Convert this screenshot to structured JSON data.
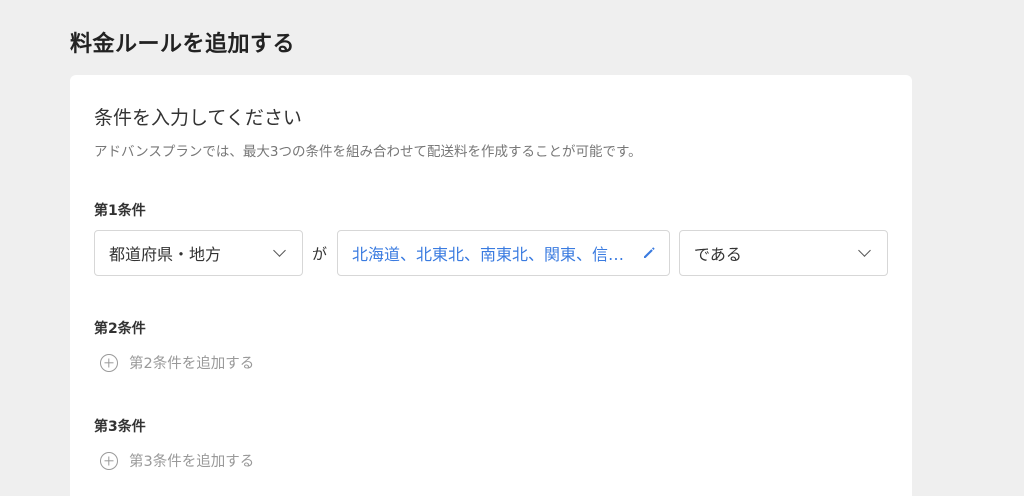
{
  "page": {
    "title": "料金ルールを追加する"
  },
  "section": {
    "title": "条件を入力してください",
    "description": "アドバンスプランでは、最大3つの条件を組み合わせて配送料を作成することが可能です。"
  },
  "condition1": {
    "label": "第1条件",
    "field_select": "都道府県・地方",
    "connector": "が",
    "value": "北海道、北東北、南東北、関東、信越、北陸、東海、関西、中国、四国、九州、沖縄",
    "operator_select": "である"
  },
  "condition2": {
    "label": "第2条件",
    "add_label": "第2条件を追加する"
  },
  "condition3": {
    "label": "第3条件",
    "add_label": "第3条件を追加する"
  },
  "colors": {
    "accent": "#3a7be0",
    "muted": "#999999",
    "background": "#efefef"
  },
  "icons": {
    "edit": "pencil-icon",
    "add": "plus-circle-icon",
    "dropdown": "chevron-down-icon"
  }
}
